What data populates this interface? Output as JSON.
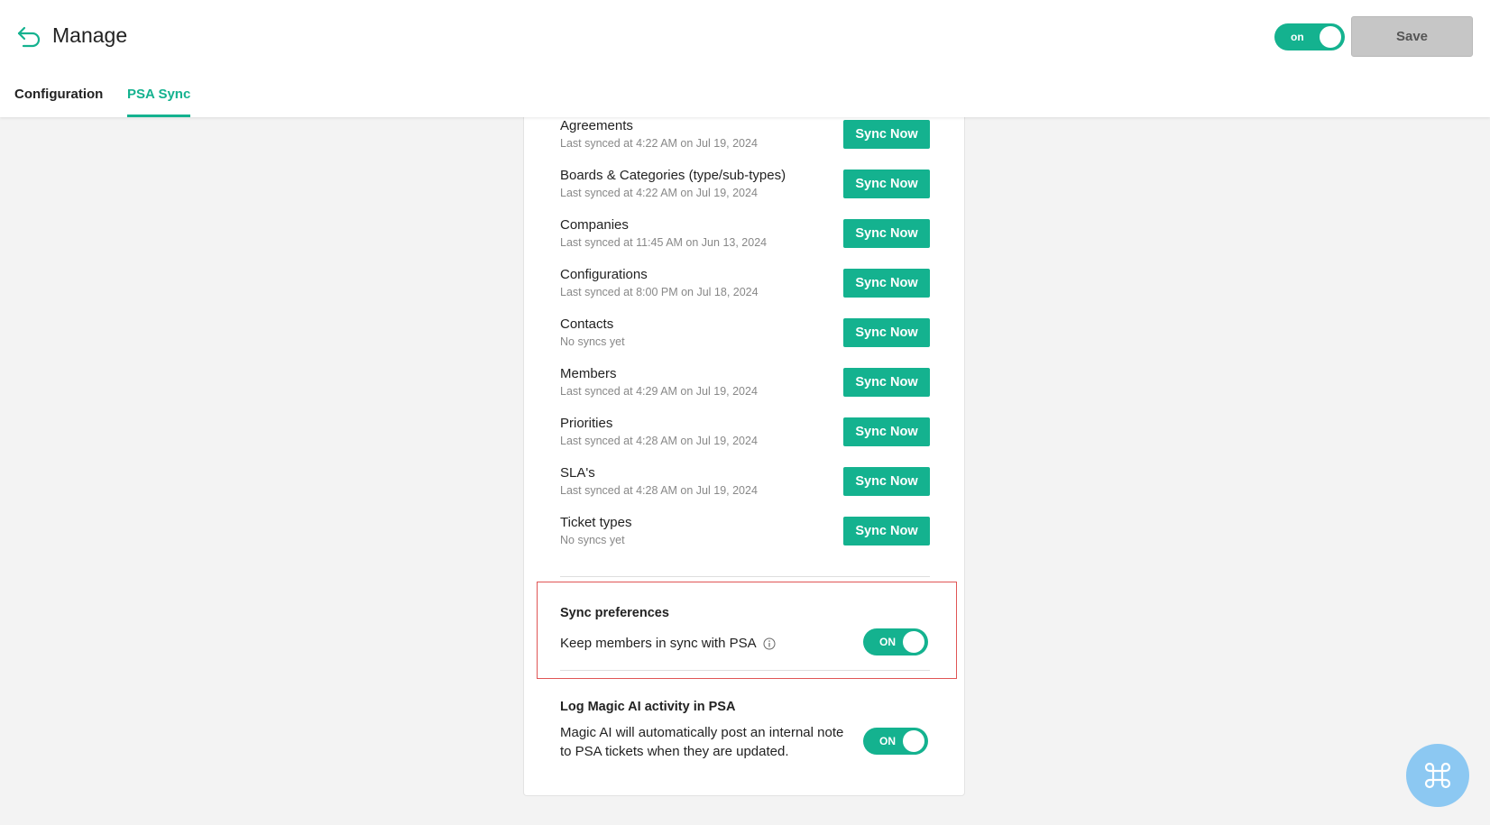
{
  "header": {
    "title": "Manage",
    "toggle_label": "on",
    "save_label": "Save"
  },
  "tabs": [
    {
      "label": "Configuration",
      "active": false
    },
    {
      "label": "PSA Sync",
      "active": true
    }
  ],
  "sync_items": [
    {
      "name": "Agreements",
      "status": "Last synced at 4:22 AM on Jul 19, 2024",
      "button": "Sync Now"
    },
    {
      "name": "Boards & Categories (type/sub-types)",
      "status": "Last synced at 4:22 AM on Jul 19, 2024",
      "button": "Sync Now"
    },
    {
      "name": "Companies",
      "status": "Last synced at 11:45 AM on Jun 13, 2024",
      "button": "Sync Now"
    },
    {
      "name": "Configurations",
      "status": "Last synced at 8:00 PM on Jul 18, 2024",
      "button": "Sync Now"
    },
    {
      "name": "Contacts",
      "status": "No syncs yet",
      "button": "Sync Now"
    },
    {
      "name": "Members",
      "status": "Last synced at 4:29 AM on Jul 19, 2024",
      "button": "Sync Now"
    },
    {
      "name": "Priorities",
      "status": "Last synced at 4:28 AM on Jul 19, 2024",
      "button": "Sync Now"
    },
    {
      "name": "SLA's",
      "status": "Last synced at 4:28 AM on Jul 19, 2024",
      "button": "Sync Now"
    },
    {
      "name": "Ticket types",
      "status": "No syncs yet",
      "button": "Sync Now"
    }
  ],
  "sync_preferences": {
    "title": "Sync preferences",
    "keep_members_label": "Keep members in sync with PSA",
    "toggle_label": "ON"
  },
  "magic_ai": {
    "title": "Log Magic AI activity in PSA",
    "description": "Magic AI will automatically post an internal note to PSA tickets when they are updated.",
    "toggle_label": "ON"
  },
  "colors": {
    "accent": "#14b28f",
    "highlight_border": "#e05555",
    "fab": "#8cc8f2"
  },
  "icons": {
    "back": "back-arrow-icon",
    "info": "info-icon",
    "fab": "command-icon"
  }
}
